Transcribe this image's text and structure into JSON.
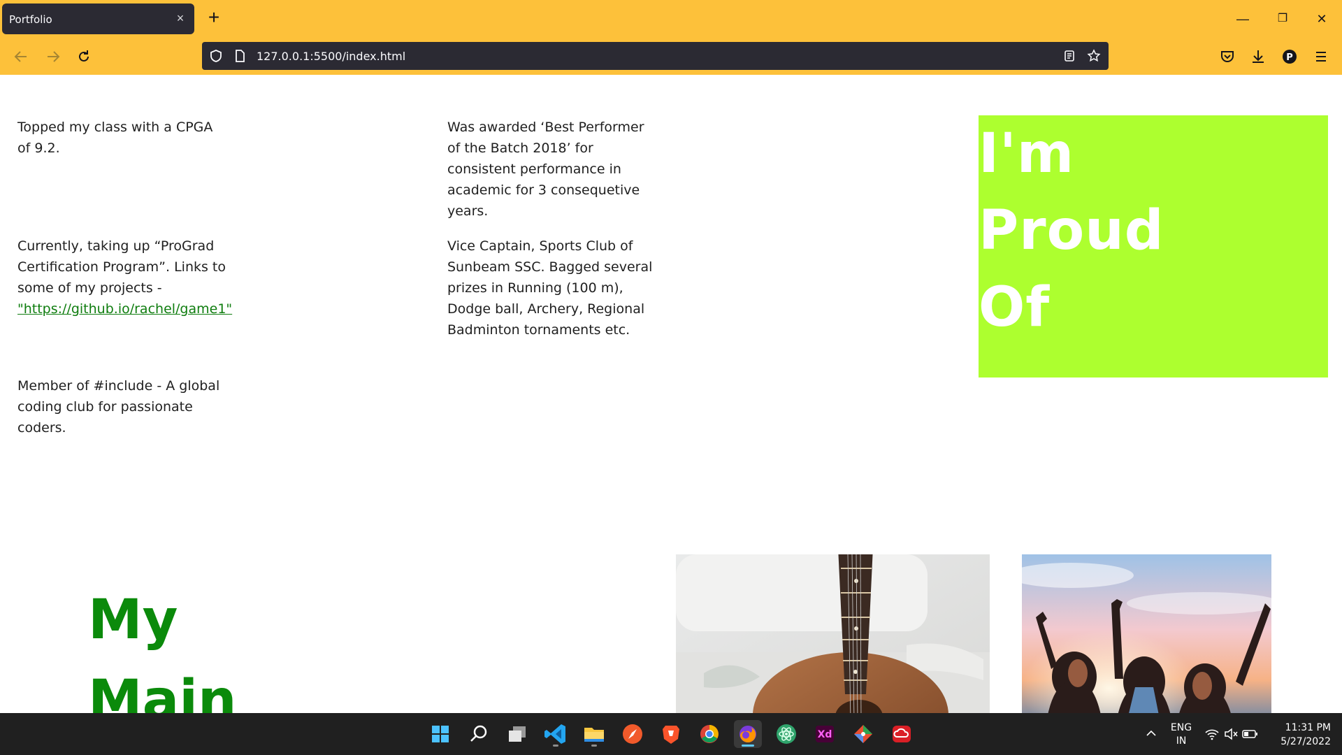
{
  "browser": {
    "tab_title": "Portfolio",
    "tab_close": "×",
    "new_tab": "+",
    "url": "127.0.0.1:5500/index.html",
    "window_controls": {
      "minimize": "—",
      "restore": "❐",
      "close": "✕"
    }
  },
  "page": {
    "achievements_left": [
      "Topped my class with a CPGA of 9.2.",
      "Currently, taking up “ProGrad Certification Program”. Links to some of my projects -",
      "Member of #include - A global coding club for passionate coders."
    ],
    "project_link": "\"https://github.io/rachel/game1\"",
    "achievements_right": [
      "Was awarded ‘Best Performer of the Batch 2018’ for consistent performance in academic for 3 consequetive years.",
      "Vice Captain, Sports Club of Sunbeam SSC. Bagged several prizes in Running (100 m), Dodge ball, Archery, Regional Badminton tornaments etc."
    ],
    "proud_heading": [
      "I'm",
      "Proud",
      "Of"
    ],
    "main_heading": [
      "My",
      "Main"
    ],
    "colors": {
      "proud_bg": "#adff2f",
      "heading_green": "#0b8a0b",
      "link_green": "#0f7d0f",
      "chrome": "#fdc13a"
    }
  },
  "taskbar": {
    "apps": [
      "start-icon",
      "search-icon",
      "task-view-icon",
      "vscode-icon",
      "file-explorer-icon",
      "swift-icon",
      "brave-icon",
      "chrome-icon",
      "firefox-icon",
      "atom-icon",
      "adobe-xd-icon",
      "git-icon",
      "creative-cloud-icon"
    ],
    "xd_label": "Xd",
    "language_top": "ENG",
    "language_bottom": "IN",
    "time": "11:31 PM",
    "date": "5/27/2022",
    "tray_chevron": "^"
  }
}
